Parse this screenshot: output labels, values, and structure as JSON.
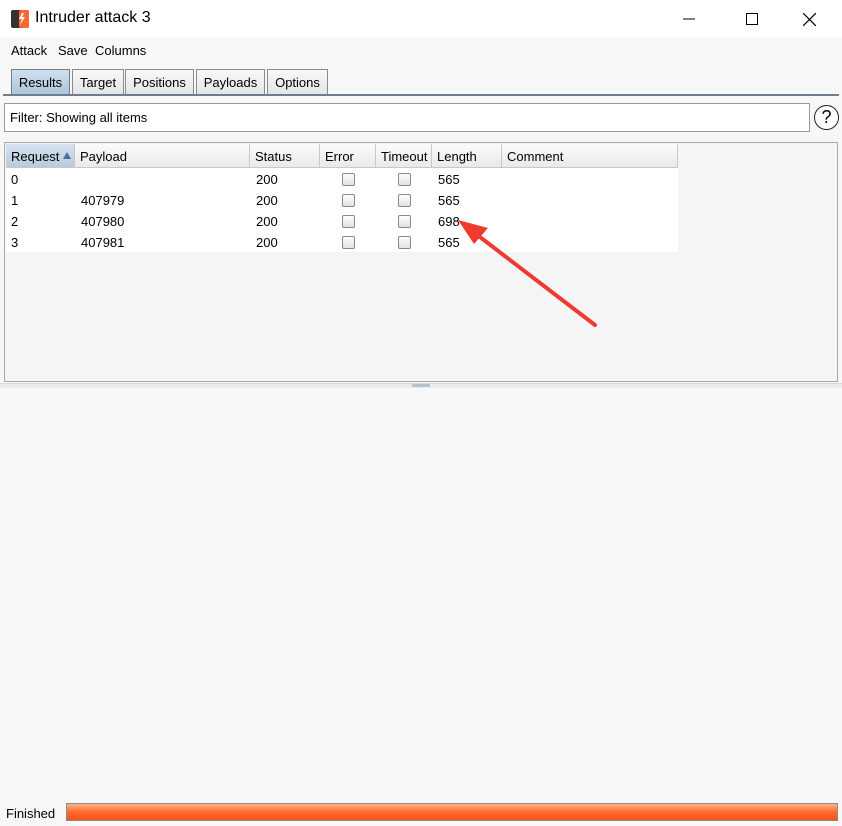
{
  "window": {
    "title": "Intruder attack 3",
    "accent_color": "#ff6633"
  },
  "menu": {
    "items": [
      {
        "label": "Attack"
      },
      {
        "label": "Save"
      },
      {
        "label": "Columns"
      }
    ]
  },
  "tabs": [
    {
      "label": "Results",
      "active": true
    },
    {
      "label": "Target",
      "active": false
    },
    {
      "label": "Positions",
      "active": false
    },
    {
      "label": "Payloads",
      "active": false
    },
    {
      "label": "Options",
      "active": false
    }
  ],
  "filter": {
    "text": "Filter: Showing all items",
    "help_icon": "question-mark-icon"
  },
  "table": {
    "columns": [
      "Request",
      "Payload",
      "Status",
      "Error",
      "Timeout",
      "Length",
      "Comment"
    ],
    "sorted_column": "Request",
    "sort_direction": "ascending",
    "rows": [
      {
        "request": "0",
        "payload": "",
        "status": "200",
        "error": false,
        "timeout": false,
        "length": "565",
        "comment": ""
      },
      {
        "request": "1",
        "payload": "407979",
        "status": "200",
        "error": false,
        "timeout": false,
        "length": "565",
        "comment": ""
      },
      {
        "request": "2",
        "payload": "407980",
        "status": "200",
        "error": false,
        "timeout": false,
        "length": "698",
        "comment": ""
      },
      {
        "request": "3",
        "payload": "407981",
        "status": "200",
        "error": false,
        "timeout": false,
        "length": "565",
        "comment": ""
      }
    ]
  },
  "annotation": {
    "arrow_color": "#ef3b2f",
    "points_to": "length-698"
  },
  "status_bar": {
    "label": "Finished",
    "progress_percent": 100,
    "progress_color": "#ff6a2a"
  }
}
